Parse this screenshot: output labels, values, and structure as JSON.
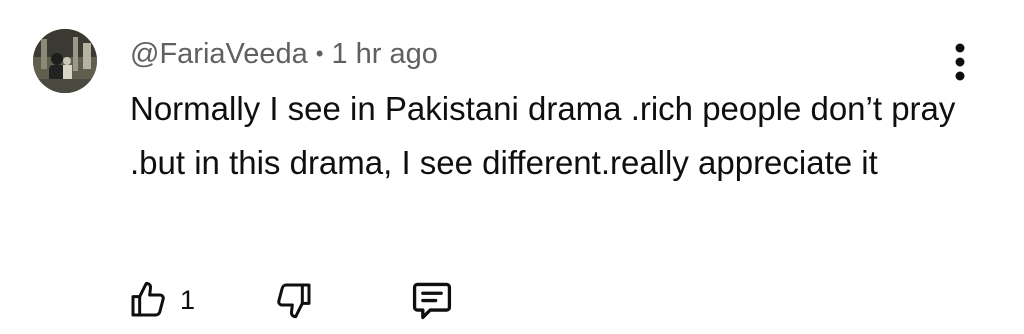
{
  "comment": {
    "author": "@FariaVeeda",
    "separator": "•",
    "time": "1 hr ago",
    "text": "Normally I see in Pakistani drama .rich people don’t pray .but in this drama, I see different.really appreciate it",
    "like_count": "1"
  },
  "icons": {
    "menu": "more-vertical-icon",
    "like": "thumbs-up-icon",
    "dislike": "thumbs-down-icon",
    "reply": "reply-comment-icon"
  },
  "colors": {
    "text": "#0f0f0f",
    "meta": "#606060"
  }
}
